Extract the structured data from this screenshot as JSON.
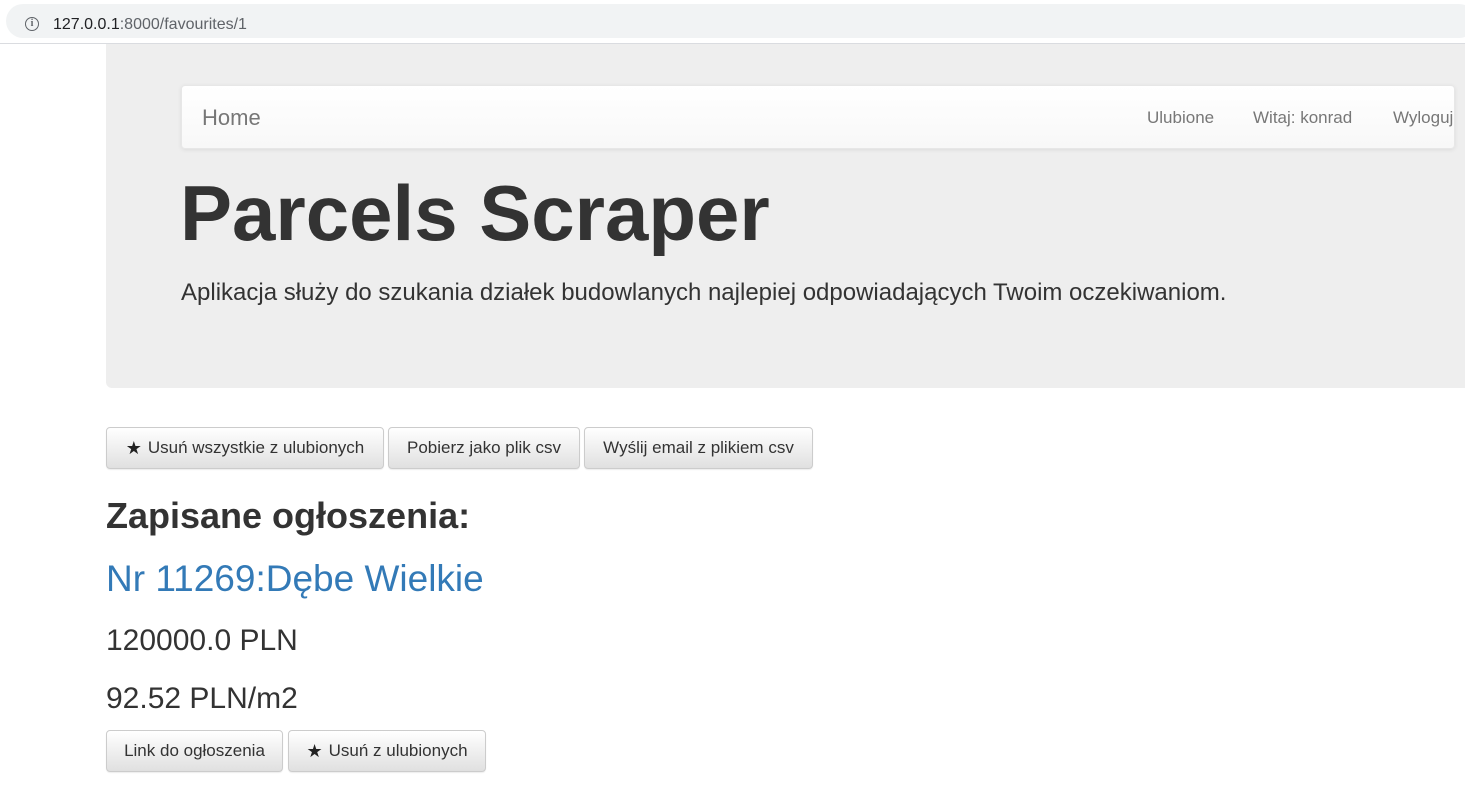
{
  "browser": {
    "url_host": "127.0.0.1",
    "url_rest": ":8000/favourites/1",
    "info_icon": "info-icon"
  },
  "navbar": {
    "brand": "Home",
    "links": [
      "Ulubione",
      "Witaj: konrad",
      "Wyloguj"
    ]
  },
  "jumbotron": {
    "title": "Parcels Scraper",
    "lead": "Aplikacja służy do szukania działek budowlanych najlepiej odpowiadających Twoim oczekiwaniom."
  },
  "actions": {
    "remove_all": "Usuń wszystkie z ulubionych",
    "download_csv": "Pobierz jako plik csv",
    "email_csv": "Wyślij email z plikiem csv"
  },
  "section_title": "Zapisane ogłoszenia:",
  "listings": [
    {
      "title": "Nr 11269:Dębe Wielkie",
      "price": "120000.0 PLN",
      "price_per_m2": "92.52 PLN/m2",
      "link_label": "Link do ogłoszenia",
      "remove_label": "Usuń z ulubionych"
    }
  ],
  "colors": {
    "link": "#337ab7",
    "jumbotron_bg": "#eeeeee",
    "text": "#333333"
  }
}
